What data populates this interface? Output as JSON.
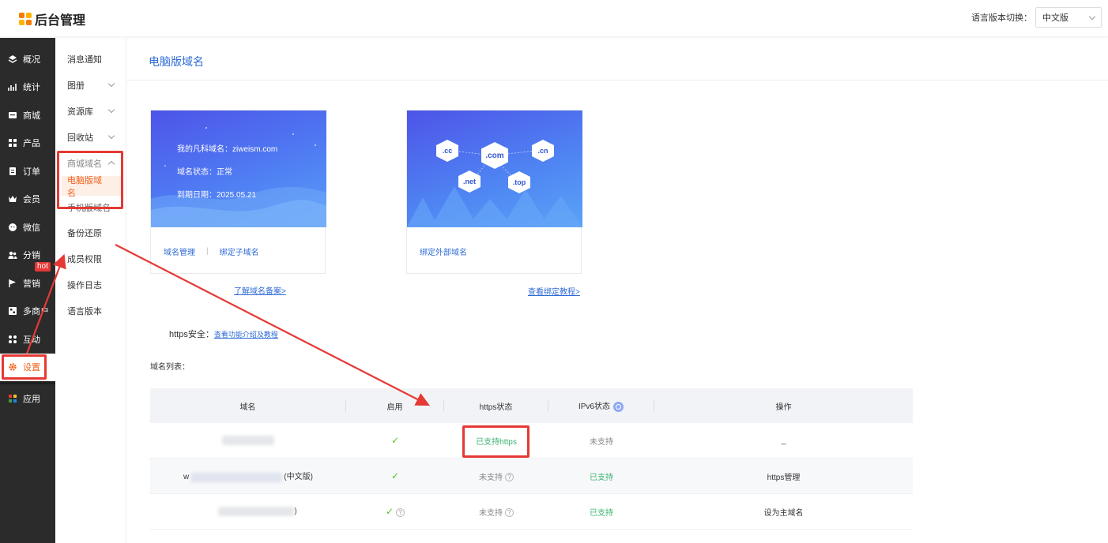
{
  "app": {
    "title": "后台管理"
  },
  "header": {
    "lang_label": "语言版本切换：",
    "lang_value": "中文版"
  },
  "sidebar": {
    "items": [
      {
        "label": "概况",
        "icon": "layers-icon"
      },
      {
        "label": "统计",
        "icon": "chart-icon"
      },
      {
        "label": "商城",
        "icon": "store-icon"
      },
      {
        "label": "产品",
        "icon": "grid-icon"
      },
      {
        "label": "订单",
        "icon": "clipboard-icon"
      },
      {
        "label": "会员",
        "icon": "crown-icon"
      },
      {
        "label": "微信",
        "icon": "wechat-icon"
      },
      {
        "label": "分销",
        "icon": "users-icon"
      },
      {
        "label": "营销",
        "icon": "flag-icon",
        "badge": "hot"
      },
      {
        "label": "多商户",
        "icon": "shop-icon"
      },
      {
        "label": "互动",
        "icon": "apps-icon"
      },
      {
        "label": "设置",
        "icon": "gear-icon"
      },
      {
        "label": "应用",
        "icon": "app-grid-icon"
      }
    ]
  },
  "submenu": {
    "items": [
      {
        "label": "消息通知"
      },
      {
        "label": "图册"
      },
      {
        "label": "资源库"
      },
      {
        "label": "回收站"
      },
      {
        "label": "商城域名"
      },
      {
        "label": "电脑版域名"
      },
      {
        "label": "手机版域名"
      },
      {
        "label": "备份还原"
      },
      {
        "label": "成员权限"
      },
      {
        "label": "操作日志"
      },
      {
        "label": "语言版本"
      }
    ]
  },
  "main": {
    "title": "电脑版域名",
    "card1": {
      "site_line": "我的凡科域名：ziweism.com",
      "status_line": "域名状态：正常",
      "expire_line": "到期日期：2025.05.21",
      "action1": "域名管理",
      "action2": "绑定子域名",
      "divider": "|"
    },
    "card2": {
      "hex": [
        ".cc",
        ".com",
        ".cn",
        ".net",
        ".top"
      ],
      "action1": "绑定外部域名"
    },
    "link1": "了解域名备案>",
    "link2": "查看绑定教程>",
    "https_label": "https安全：",
    "https_link": "查看功能介绍及教程",
    "list_label": "域名列表：",
    "table": {
      "headers": [
        "域名",
        "启用",
        "https状态",
        "IPv6状态",
        "操作"
      ],
      "rows": [
        {
          "domain_prefix": "",
          "domain_suffix": "",
          "enabled": "✓",
          "https": "已支持https",
          "ipv6": "未支持",
          "action": "_"
        },
        {
          "domain_prefix": "w",
          "domain_suffix": "(中文版)",
          "enabled": "✓",
          "https": "未支持",
          "ipv6": "已支持",
          "action": "https管理"
        },
        {
          "domain_prefix": "",
          "domain_suffix": ")",
          "enabled": "✓",
          "https": "未支持",
          "ipv6": "已支持",
          "action": "设为主域名"
        }
      ]
    }
  }
}
